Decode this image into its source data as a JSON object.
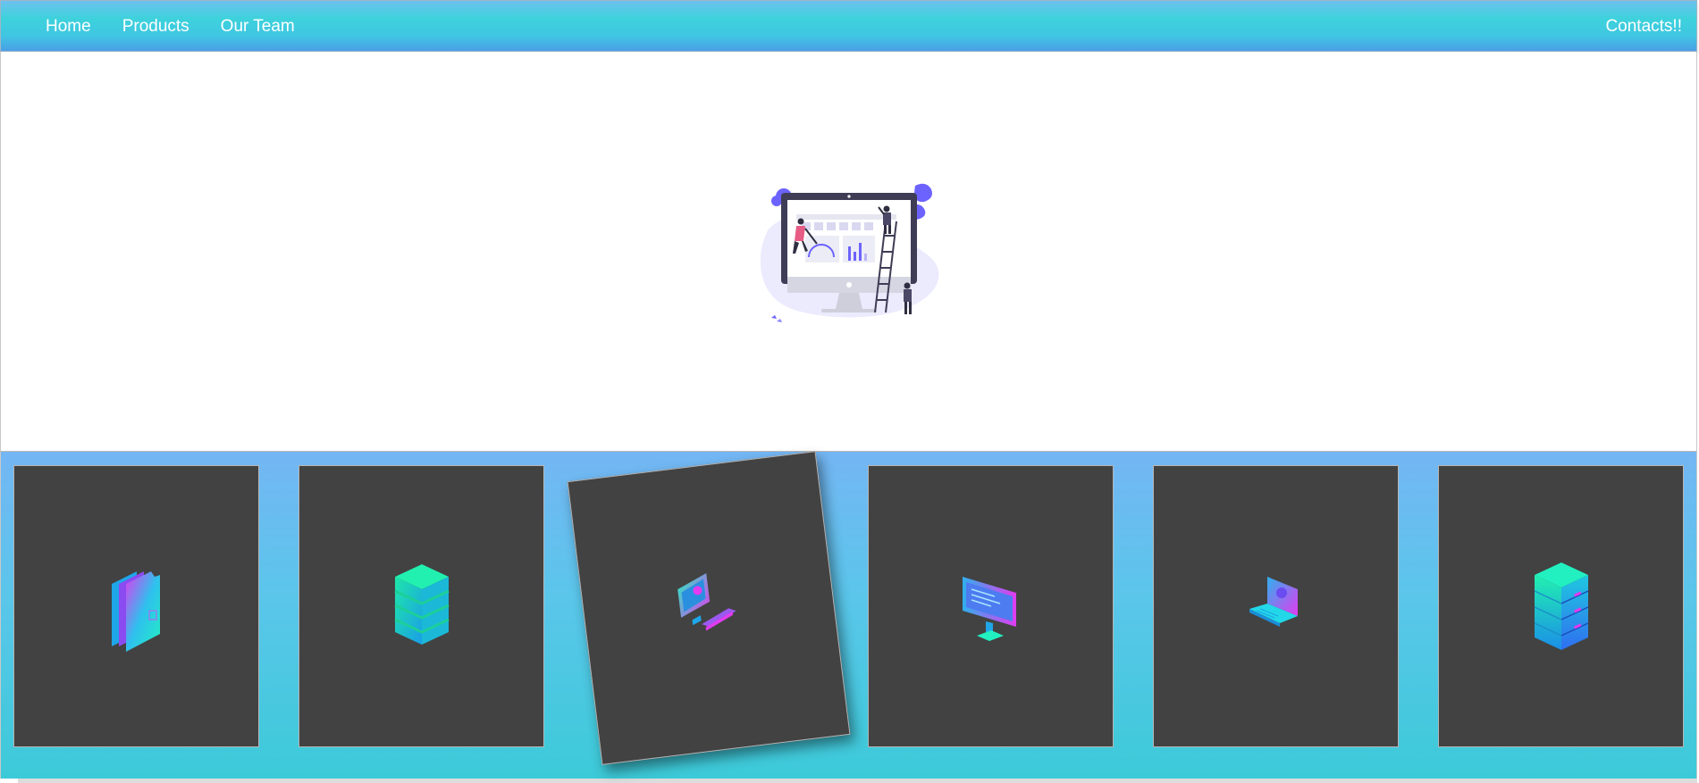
{
  "nav": {
    "links": [
      {
        "label": "Home"
      },
      {
        "label": "Products"
      },
      {
        "label": "Our Team"
      }
    ],
    "contacts_label": "Contacts!!"
  },
  "hero": {
    "illustration": "dashboard-team-illustration"
  },
  "products": {
    "cards": [
      {
        "icon": "folders-icon",
        "tilted": false
      },
      {
        "icon": "database-stack-icon",
        "tilted": false
      },
      {
        "icon": "desktop-workstation-icon",
        "tilted": true
      },
      {
        "icon": "monitor-icon",
        "tilted": false
      },
      {
        "icon": "laptop-icon",
        "tilted": false
      },
      {
        "icon": "server-rack-icon",
        "tilted": false
      }
    ]
  },
  "colors": {
    "nav_gradient_top": "#6ec1f0",
    "nav_gradient_mid": "#3dd2dc",
    "strip_top": "#74b6f4",
    "strip_bottom": "#3ccad8",
    "card_bg": "#424242",
    "icon_cyan": "#20e3e6",
    "icon_magenta": "#e23bf0",
    "illustration_accent": "#6c63ff"
  }
}
